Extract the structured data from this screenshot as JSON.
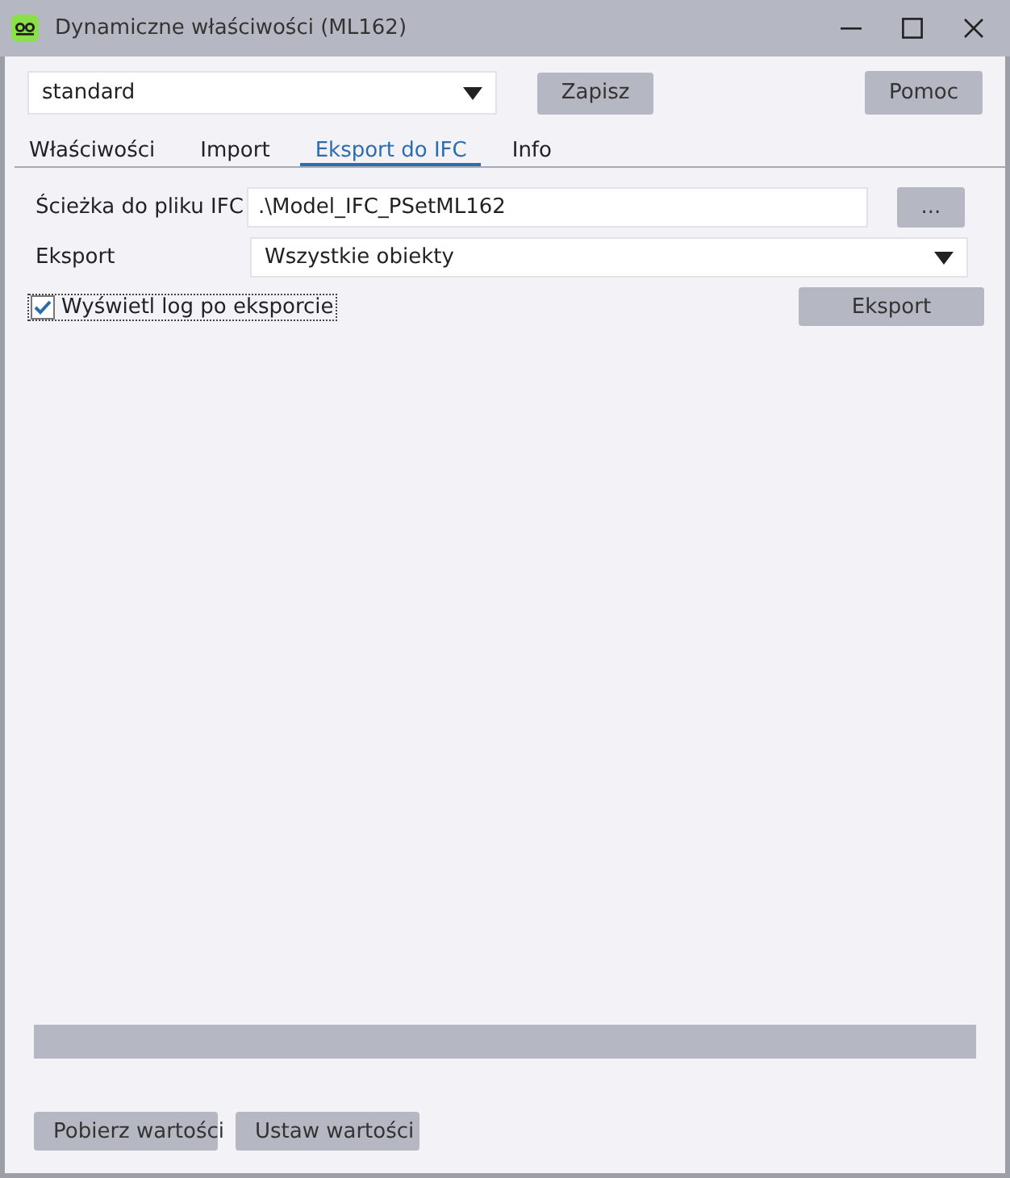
{
  "window": {
    "title": "Dynamiczne właściwości (ML162)"
  },
  "toolbar": {
    "profile": "standard",
    "buttons": [
      "Zapisz",
      "Pomoc"
    ]
  },
  "tabs": [
    {
      "label": "Właściwości",
      "selected": false
    },
    {
      "label": "Import",
      "selected": false
    },
    {
      "label": "Eksport do IFC",
      "selected": true
    },
    {
      "label": "Info",
      "selected": false
    }
  ],
  "form": {
    "path_label": "Ścieżka do pliku IFC",
    "path_value": ".\\Model_IFC_PSetML162",
    "browse_button": "...",
    "export_label": "Eksport",
    "export_value": "Wszystkie obiekty",
    "log_checkbox": {
      "label": "Wyświetl log po eksporcie",
      "checked": true
    },
    "export_button": "Eksport"
  },
  "progress": {
    "level": 0
  },
  "footer_buttons": [
    "Pobierz wartości",
    "Ustaw wartości"
  ]
}
